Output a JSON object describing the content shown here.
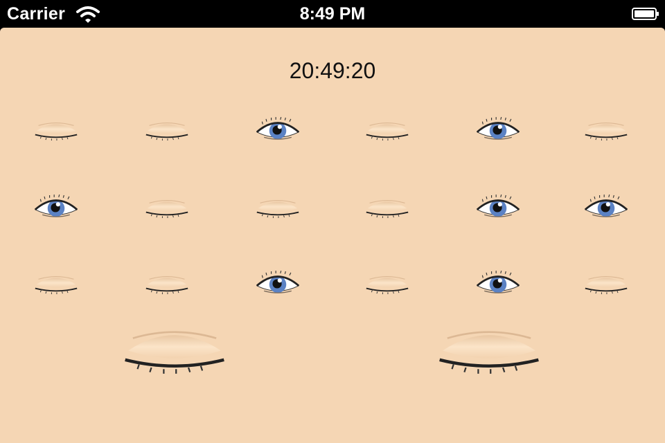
{
  "status_bar": {
    "carrier": "Carrier",
    "time": "8:49 PM",
    "wifi_icon": "wifi-icon",
    "battery_icon": "battery-icon"
  },
  "screen": {
    "clock": "20:49:20",
    "background_color": "#f5d6b4",
    "iris_color": "#5b82c4",
    "eye_rows": [
      [
        "closed",
        "closed",
        "open",
        "closed",
        "open",
        "closed"
      ],
      [
        "open",
        "closed",
        "closed",
        "closed",
        "open",
        "open"
      ],
      [
        "closed",
        "closed",
        "open",
        "closed",
        "open",
        "closed"
      ]
    ],
    "large_eyes": [
      "closed",
      "closed"
    ]
  }
}
